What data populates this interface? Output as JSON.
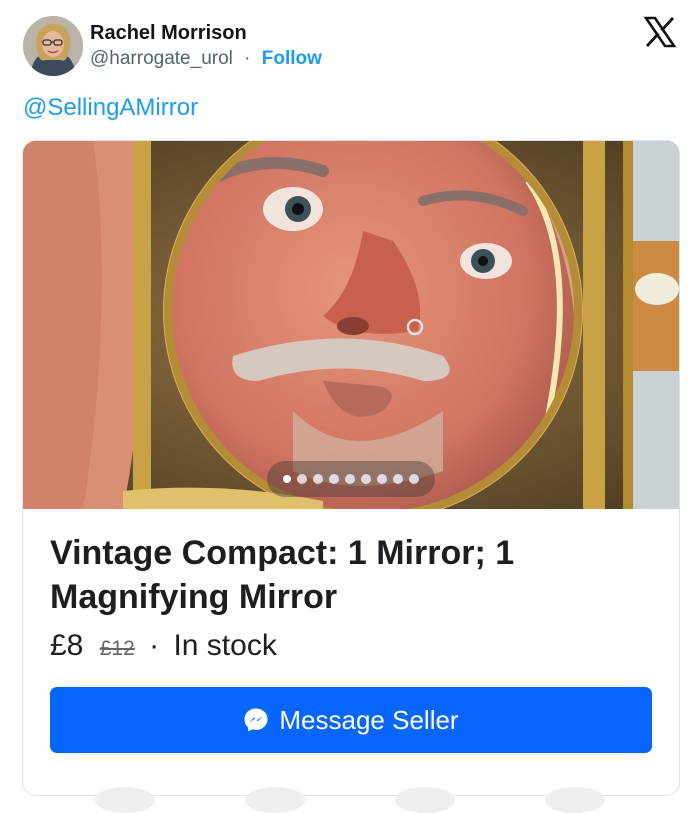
{
  "author": {
    "name": "Rachel Morrison",
    "handle": "@harrogate_urol",
    "separator": "·",
    "follow_label": "Follow",
    "avatar_icon": "profile-photo"
  },
  "platform_icon": "x-logo-icon",
  "tweet": {
    "text": "@SellingAMirror"
  },
  "listing": {
    "photo_alt": "man-looking-into-magnifying-mirror",
    "carousel": {
      "total": 9,
      "active_index": 0
    },
    "title": "Vintage Compact: 1 Mirror; 1 Magnifying Mirror",
    "price": "£8",
    "original_price": "£12",
    "separator": "·",
    "stock_status": "In stock",
    "cta_label": "Message Seller",
    "cta_icon": "messenger-icon"
  },
  "colors": {
    "link_blue": "#1d9bf0",
    "cta_blue": "#0866ff"
  }
}
